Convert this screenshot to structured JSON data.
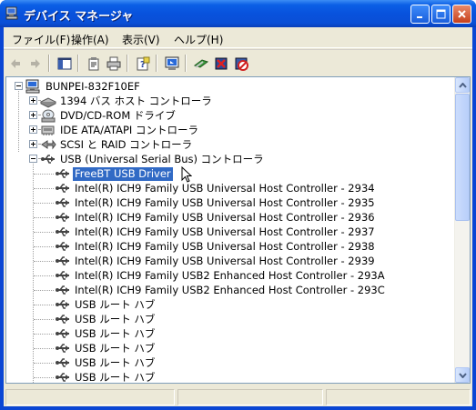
{
  "window": {
    "title": "デバイス マネージャ",
    "title_bar_color": "#0a46d4"
  },
  "menu": [
    {
      "label": "ファイル(F)"
    },
    {
      "label": "操作(A)"
    },
    {
      "label": "表示(V)"
    },
    {
      "label": "ヘルプ(H)"
    }
  ],
  "toolbar": {
    "buttons": [
      {
        "icon": "back-arrow-icon",
        "enabled": false
      },
      {
        "icon": "forward-arrow-icon",
        "enabled": false
      },
      {
        "icon": "show-hide-console-tree-icon",
        "enabled": true
      },
      {
        "icon": "properties-icon",
        "enabled": true
      },
      {
        "icon": "print-icon",
        "enabled": true
      },
      {
        "icon": "help-icon",
        "enabled": true
      },
      {
        "icon": "scan-hardware-changes-icon",
        "enabled": true
      },
      {
        "icon": "update-driver-icon",
        "enabled": true
      },
      {
        "icon": "uninstall-icon",
        "enabled": true
      },
      {
        "icon": "disable-icon",
        "enabled": true
      }
    ]
  },
  "tree": {
    "root": {
      "label": "BUNPEI-832F10EF",
      "icon": "computer-icon",
      "expanded": true
    },
    "categories": [
      {
        "label": "1394 バス ホスト コントローラ",
        "icon": "bus-controller-icon",
        "expanded": false
      },
      {
        "label": "DVD/CD-ROM ドライブ",
        "icon": "cdrom-icon",
        "expanded": false
      },
      {
        "label": "IDE ATA/ATAPI コントローラ",
        "icon": "ide-controller-icon",
        "expanded": false
      },
      {
        "label": "SCSI と RAID コントローラ",
        "icon": "scsi-icon",
        "expanded": false
      },
      {
        "label": "USB (Universal Serial Bus) コントローラ",
        "icon": "usb-icon",
        "expanded": true
      }
    ],
    "usb_devices": [
      {
        "label": "FreeBT USB Driver",
        "selected": true
      },
      {
        "label": "Intel(R) ICH9 Family USB Universal Host Controller - 2934",
        "selected": false
      },
      {
        "label": "Intel(R) ICH9 Family USB Universal Host Controller - 2935",
        "selected": false
      },
      {
        "label": "Intel(R) ICH9 Family USB Universal Host Controller - 2936",
        "selected": false
      },
      {
        "label": "Intel(R) ICH9 Family USB Universal Host Controller - 2937",
        "selected": false
      },
      {
        "label": "Intel(R) ICH9 Family USB Universal Host Controller - 2938",
        "selected": false
      },
      {
        "label": "Intel(R) ICH9 Family USB Universal Host Controller - 2939",
        "selected": false
      },
      {
        "label": "Intel(R) ICH9 Family USB2 Enhanced Host Controller - 293A",
        "selected": false
      },
      {
        "label": "Intel(R) ICH9 Family USB2 Enhanced Host Controller - 293C",
        "selected": false
      },
      {
        "label": "USB ルート ハブ",
        "selected": false
      },
      {
        "label": "USB ルート ハブ",
        "selected": false
      },
      {
        "label": "USB ルート ハブ",
        "selected": false
      },
      {
        "label": "USB ルート ハブ",
        "selected": false
      },
      {
        "label": "USB ルート ハブ",
        "selected": false
      },
      {
        "label": "USB ルート ハブ",
        "selected": false
      }
    ],
    "selection_color": "#316ac5"
  },
  "statusbar": {
    "panels": [
      "",
      "",
      ""
    ]
  }
}
